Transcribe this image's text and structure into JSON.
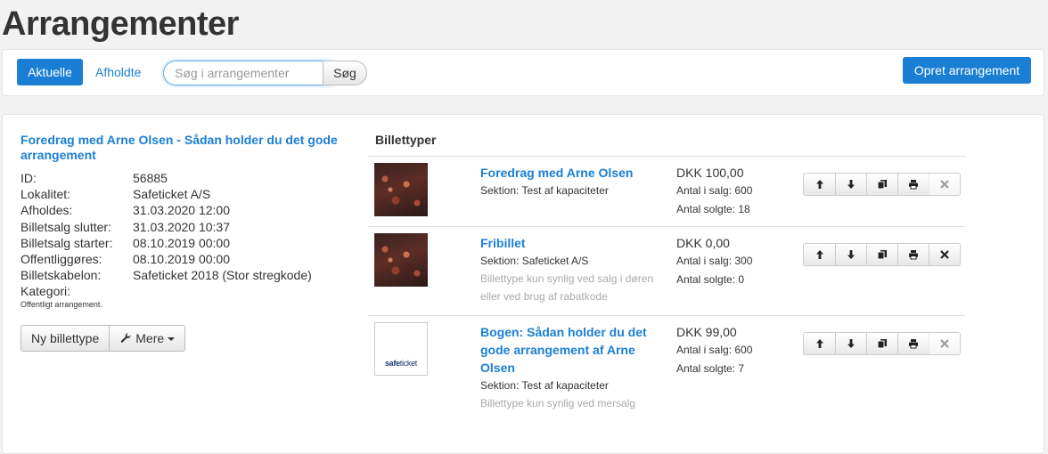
{
  "page_title": "Arrangementer",
  "toolbar": {
    "tab_active": "Aktuelle",
    "tab_past": "Afholdte",
    "search_placeholder": "Søg i arrangementer",
    "search_button": "Søg",
    "create_button": "Opret arrangement"
  },
  "event": {
    "title": "Foredrag med Arne Olsen - Sådan holder du det gode arrangement",
    "details": [
      {
        "label": "ID:",
        "value": "56885"
      },
      {
        "label": "Lokalitet:",
        "value": "Safeticket A/S"
      },
      {
        "label": "Afholdes:",
        "value": "31.03.2020 12:00"
      },
      {
        "label": "Billetsalg slutter:",
        "value": "31.03.2020 10:37"
      },
      {
        "label": "Billetsalg starter:",
        "value": "08.10.2019 00:00"
      },
      {
        "label": "Offentliggøres:",
        "value": "08.10.2019 00:00"
      },
      {
        "label": "Billetskabelon:",
        "value": "Safeticket 2018 (Stor stregkode)"
      },
      {
        "label": "Kategori:",
        "value": ""
      }
    ],
    "note": "Offentligt arrangement.",
    "new_ticket_button": "Ny billettype",
    "more_button": "Mere"
  },
  "ticket_types": {
    "header": "Billettyper",
    "items": [
      {
        "name": "Foredrag med Arne Olsen",
        "section": "Sektion: Test af kapaciteter",
        "visibility": "",
        "price": "DKK 100,00",
        "for_sale": "Antal i salg: 600",
        "sold": "Antal solgte: 18",
        "thumb": "photo",
        "delete_enabled": false
      },
      {
        "name": "Fribillet",
        "section": "Sektion: Safeticket A/S",
        "visibility": "Billettype kun synlig ved salg i døren eller ved brug af rabatkode",
        "price": "DKK 0,00",
        "for_sale": "Antal i salg: 300",
        "sold": "Antal solgte: 0",
        "thumb": "photo",
        "delete_enabled": true
      },
      {
        "name": "Bogen: Sådan holder du det gode arrangement af Arne Olsen",
        "section": "Sektion: Test af kapaciteter",
        "visibility": "Billettype kun synlig ved mersalg",
        "price": "DKK 99,00",
        "for_sale": "Antal i salg: 600",
        "sold": "Antal solgte: 7",
        "thumb": "logo",
        "logo_text_bold": "safe",
        "logo_text_light": "ticket",
        "delete_enabled": false
      }
    ]
  },
  "icons": [
    "arrow-up-icon",
    "arrow-down-icon",
    "copy-icon",
    "print-icon",
    "delete-icon",
    "wrench-icon",
    "caret-down-icon"
  ],
  "colors": {
    "accent": "#1a7fd4",
    "muted": "#aaaaaa"
  }
}
